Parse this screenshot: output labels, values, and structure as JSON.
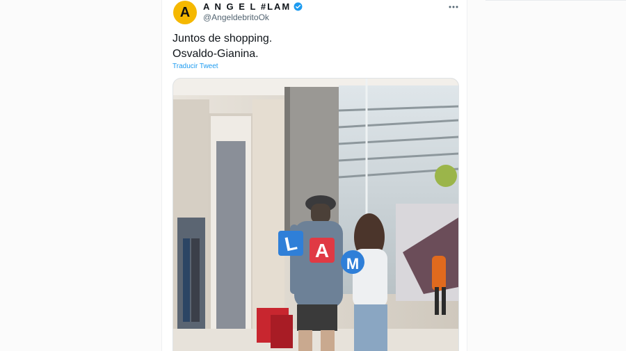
{
  "tweet": {
    "avatar_letter": "A",
    "display_name": "A N G E L #LAM",
    "handle": "@AngeldebritoOk",
    "text_lines": [
      "Juntos de shopping.",
      "Osvaldo-Gianina."
    ],
    "translate_label": "Traducir Tweet"
  },
  "media": {
    "watermark": [
      "L",
      "A",
      "M"
    ]
  },
  "colors": {
    "avatar_bg": "#f5b800",
    "link": "#1d9bf0",
    "verified": "#1d9bf0",
    "watermark_blue": "#2f7fd8",
    "watermark_red": "#e03a44"
  },
  "icons": {
    "verified": "verified-badge-icon",
    "more": "more-options-icon"
  }
}
